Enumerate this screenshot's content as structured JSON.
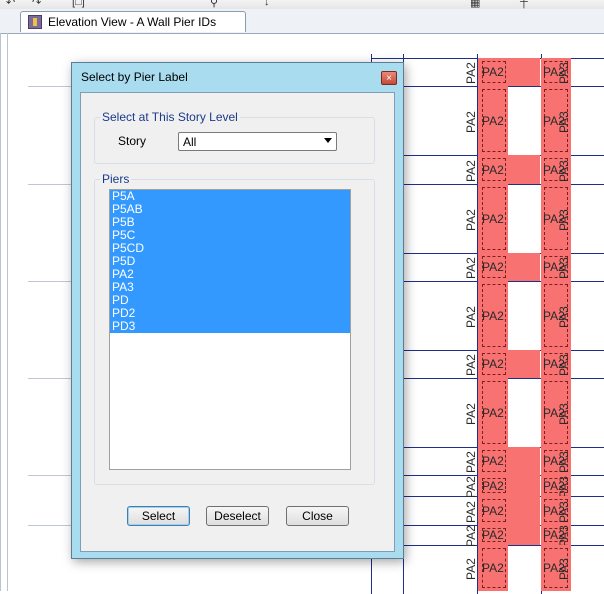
{
  "toolbar": {
    "icons": [
      "undo-icon",
      "redo-icon",
      "bracket-icon",
      "zoom-icon",
      "arrow-icon",
      "grid-icon",
      "ruler-icon"
    ]
  },
  "tab": {
    "title": "Elevation View - A  Wall Pier IDs",
    "icon": "elevation-view-icon"
  },
  "elevation": {
    "pier_label_left": "PA2",
    "pier_label_a": "PA2",
    "pier_label_b": "PA3"
  },
  "dialog": {
    "title": "Select by Pier Label",
    "close_icon": "×",
    "story_group_label": "Select at This Story Level",
    "story_label": "Story",
    "story_value": "All",
    "piers_group_label": "Piers",
    "piers": [
      "P5A",
      "P5AB",
      "P5B",
      "P5C",
      "P5CD",
      "P5D",
      "PA2",
      "PA3",
      "PD",
      "PD2",
      "PD3"
    ],
    "select_label": "Select",
    "deselect_label": "Deselect",
    "close_label": "Close"
  },
  "colors": {
    "pier_fill": "#f87272",
    "selection": "#3399ff",
    "dialog_frame": "#a9dcef",
    "grid_line": "#1e2f8a"
  }
}
